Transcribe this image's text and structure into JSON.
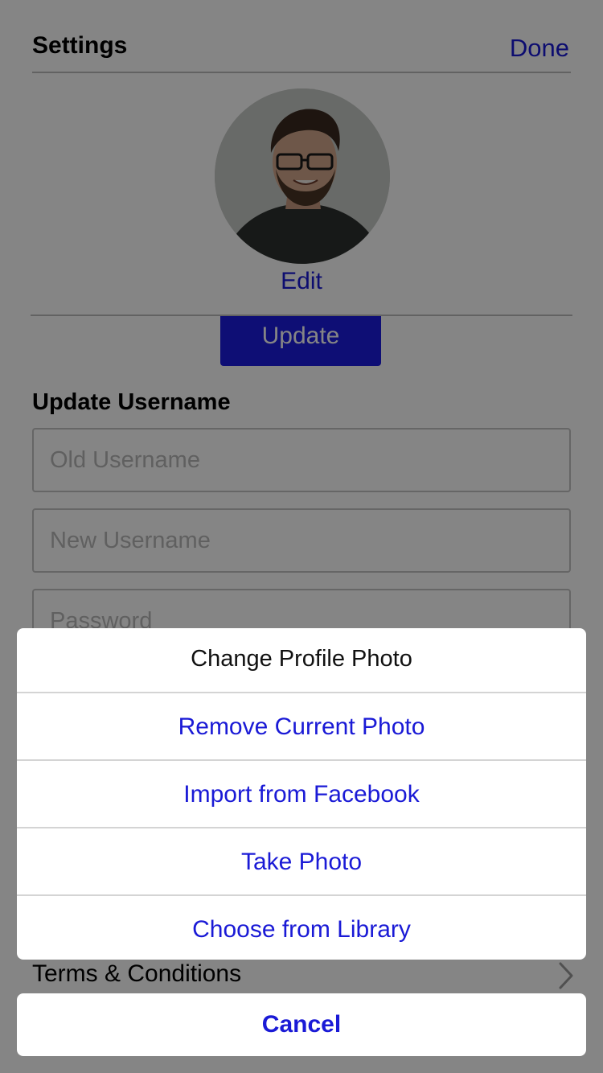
{
  "header": {
    "title": "Settings",
    "done_label": "Done"
  },
  "profile": {
    "edit_label": "Edit",
    "update_label": "Update"
  },
  "username_section": {
    "title": "Update Username",
    "old_placeholder": "Old Username",
    "new_placeholder": "New Username",
    "password_placeholder": "Password"
  },
  "terms": {
    "label": "Terms & Conditions",
    "chevron_icon": "chevron-right-icon"
  },
  "action_sheet": {
    "title": "Change Profile Photo",
    "options": [
      "Remove Current Photo",
      "Import from Facebook",
      "Take Photo",
      "Choose from Library"
    ],
    "cancel_label": "Cancel"
  },
  "colors": {
    "accent": "#1a1ad6",
    "button_bg": "#1c1ce0",
    "overlay": "rgba(0,0,0,0.48)"
  }
}
